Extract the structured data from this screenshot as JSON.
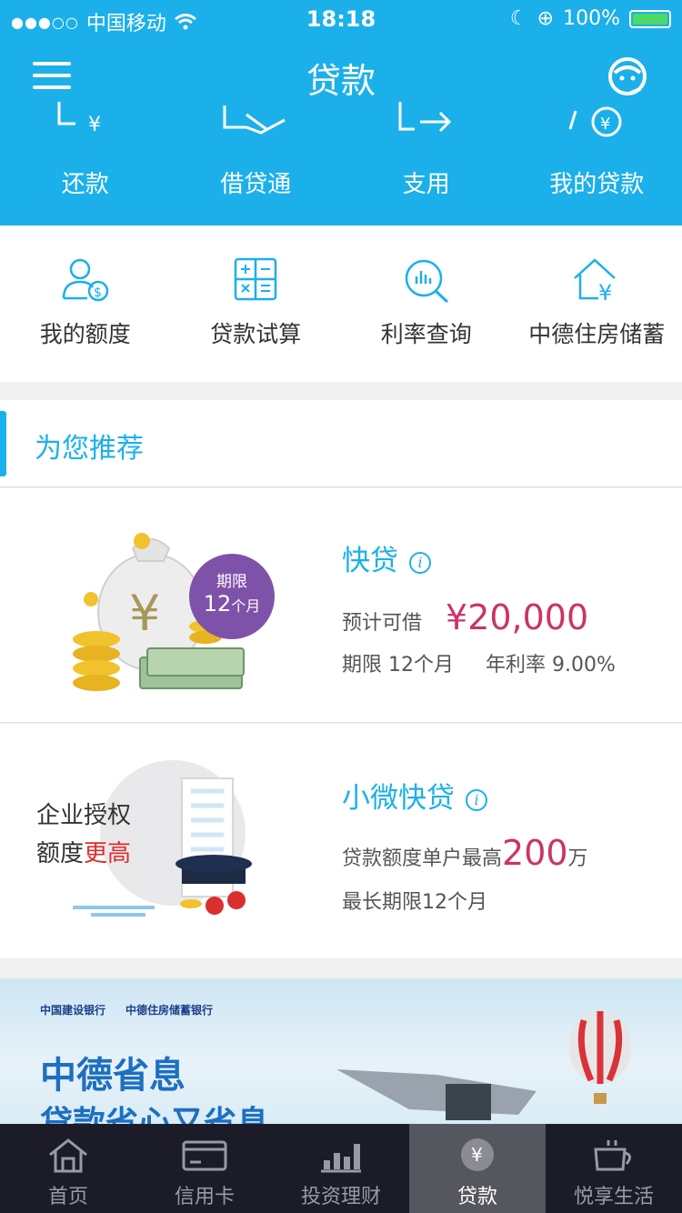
{
  "status_bar": {
    "carrier": "中国移动",
    "time": "18:18",
    "battery": "100%"
  },
  "header": {
    "title": "贷款"
  },
  "quick_actions": [
    {
      "label": "还款",
      "icon": "repay-icon"
    },
    {
      "label": "借贷通",
      "icon": "handshake-icon"
    },
    {
      "label": "支用",
      "icon": "transfer-icon"
    },
    {
      "label": "我的贷款",
      "icon": "my-loan-icon"
    }
  ],
  "tools": [
    {
      "label": "我的额度",
      "icon": "user-quota-icon"
    },
    {
      "label": "贷款试算",
      "icon": "calculator-icon"
    },
    {
      "label": "利率查询",
      "icon": "rate-search-icon"
    },
    {
      "label": "中德住房储蓄",
      "icon": "house-yen-icon"
    }
  ],
  "recommend": {
    "title": "为您推荐"
  },
  "product1": {
    "name": "快贷",
    "badge_line1": "期限",
    "badge_num": "12",
    "badge_unit": "个月",
    "estimate_label": "预计可借",
    "amount": "¥20,000",
    "term": "期限  12个月",
    "rate": "年利率  9.00%"
  },
  "product2": {
    "name": "小微快贷",
    "corp_line1": "企业授权",
    "corp_line2_a": "额度",
    "corp_line2_b": "更高",
    "quota_prefix": "贷款额度单户最高",
    "quota_num": "200",
    "quota_unit": "万",
    "term": "最长期限12个月"
  },
  "banner": {
    "logo1": "中国建设银行",
    "logo2": "中德住房储蓄银行",
    "title": "中德省息",
    "subtitle": "贷款省心又省息"
  },
  "tabbar": [
    {
      "label": "首页",
      "icon": "home-icon"
    },
    {
      "label": "信用卡",
      "icon": "credit-card-icon"
    },
    {
      "label": "投资理财",
      "icon": "investment-chart-icon"
    },
    {
      "label": "贷款",
      "icon": "yen-coin-icon"
    },
    {
      "label": "悦享生活",
      "icon": "coffee-cup-icon"
    }
  ],
  "colors": {
    "primary": "#1bb0ea",
    "amount": "#cc3366",
    "badge": "#7f52a9",
    "tabbar_bg": "#1c1c28",
    "tab_active_bg": "#56565e"
  }
}
